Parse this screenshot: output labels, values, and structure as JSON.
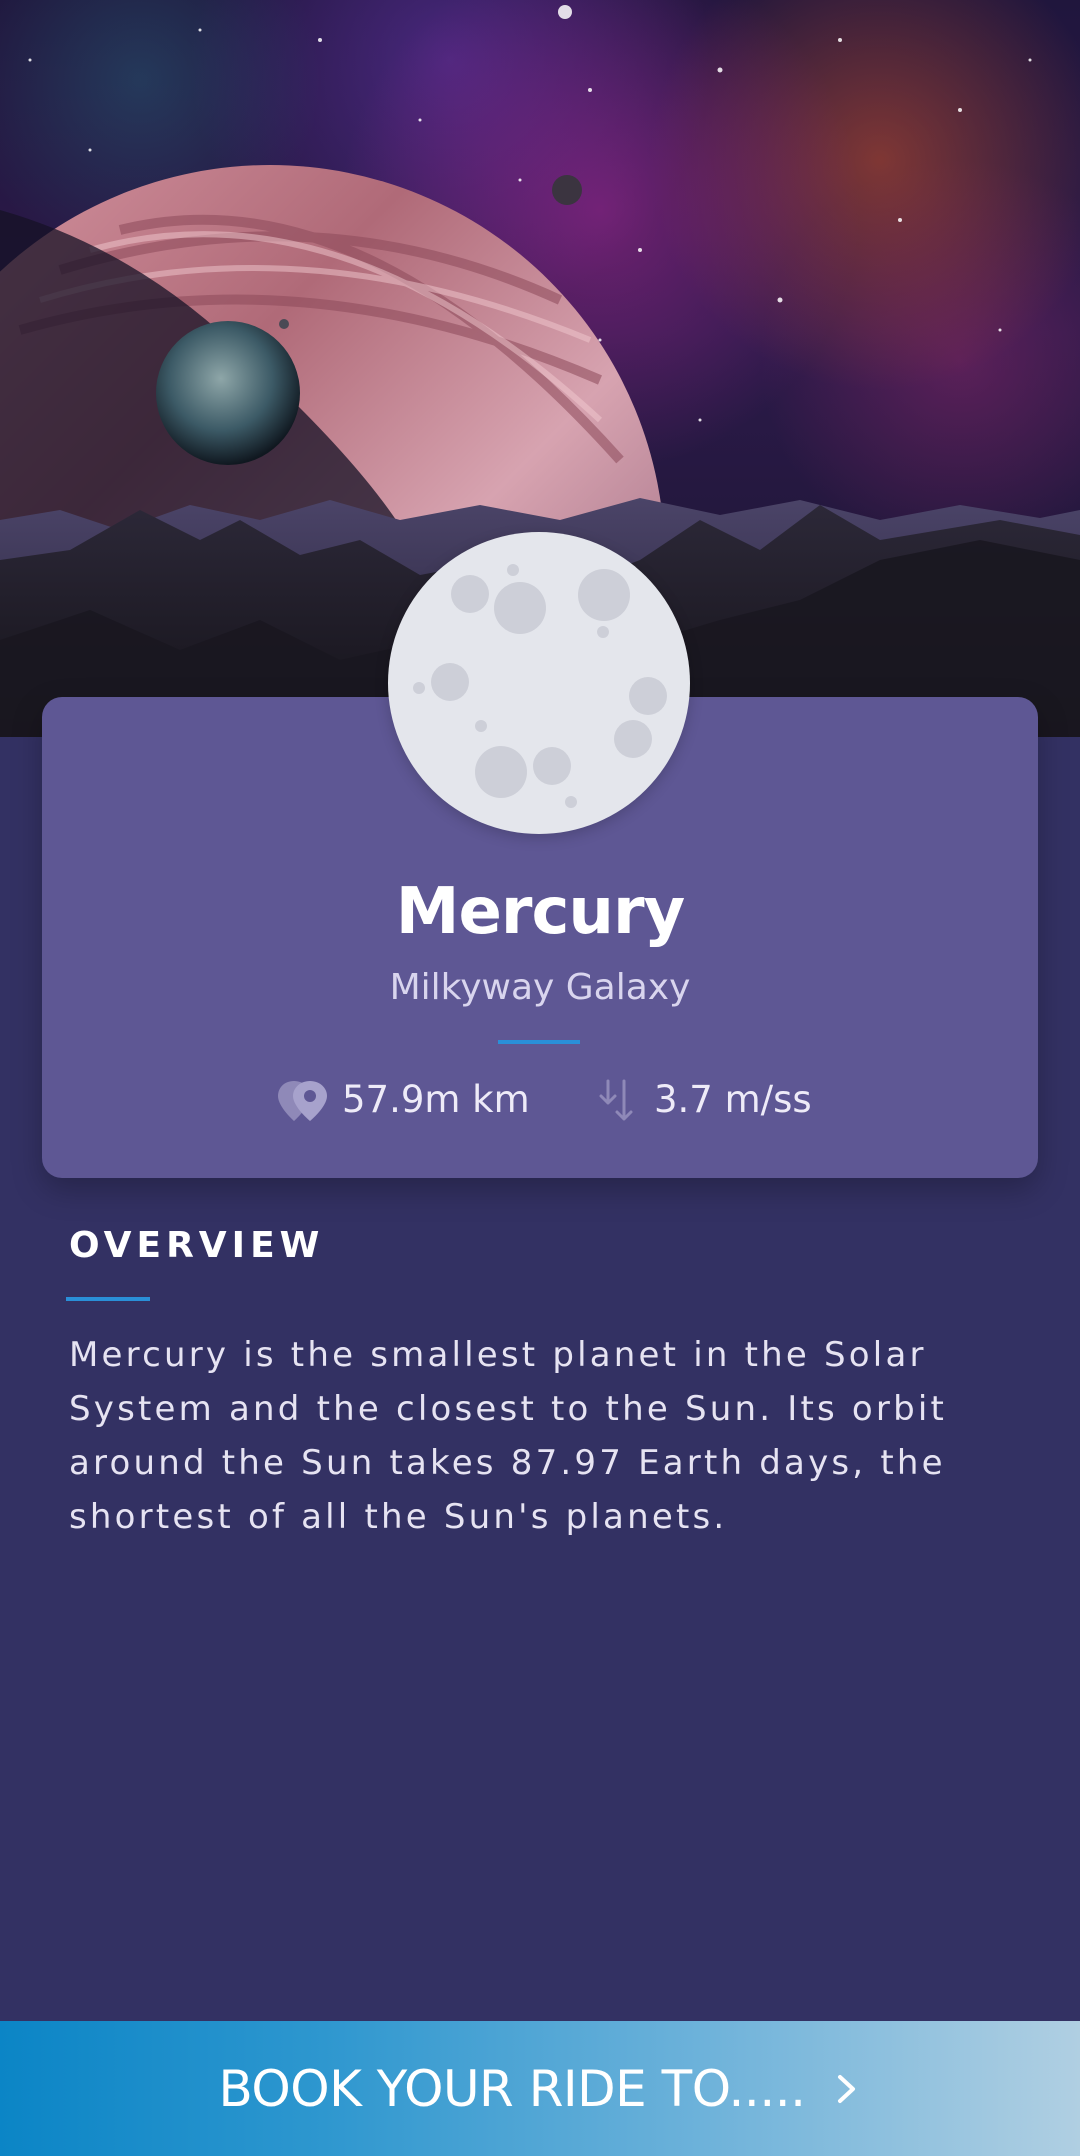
{
  "planet": {
    "name": "Mercury",
    "galaxy": "Milkyway Galaxy",
    "distance": "57.9m km",
    "gravity": "3.7 m/ss"
  },
  "overview": {
    "heading": "OVERVIEW",
    "text": "Mercury is the smallest planet in the Solar System and the closest to the Sun. Its orbit around the Sun takes 87.97 Earth days, the shortest of all the Sun's planets."
  },
  "cta": {
    "label": "BOOK YOUR RIDE TO....."
  },
  "icons": {
    "distance": "map-pin-icon",
    "gravity": "arrows-down-icon",
    "cta": "chevron-right-icon"
  },
  "colors": {
    "background": "#333163",
    "card": "#5e5794",
    "accent": "#2a8fd8",
    "planet": "#e4e6ec",
    "crater": "#cdcfd8"
  }
}
